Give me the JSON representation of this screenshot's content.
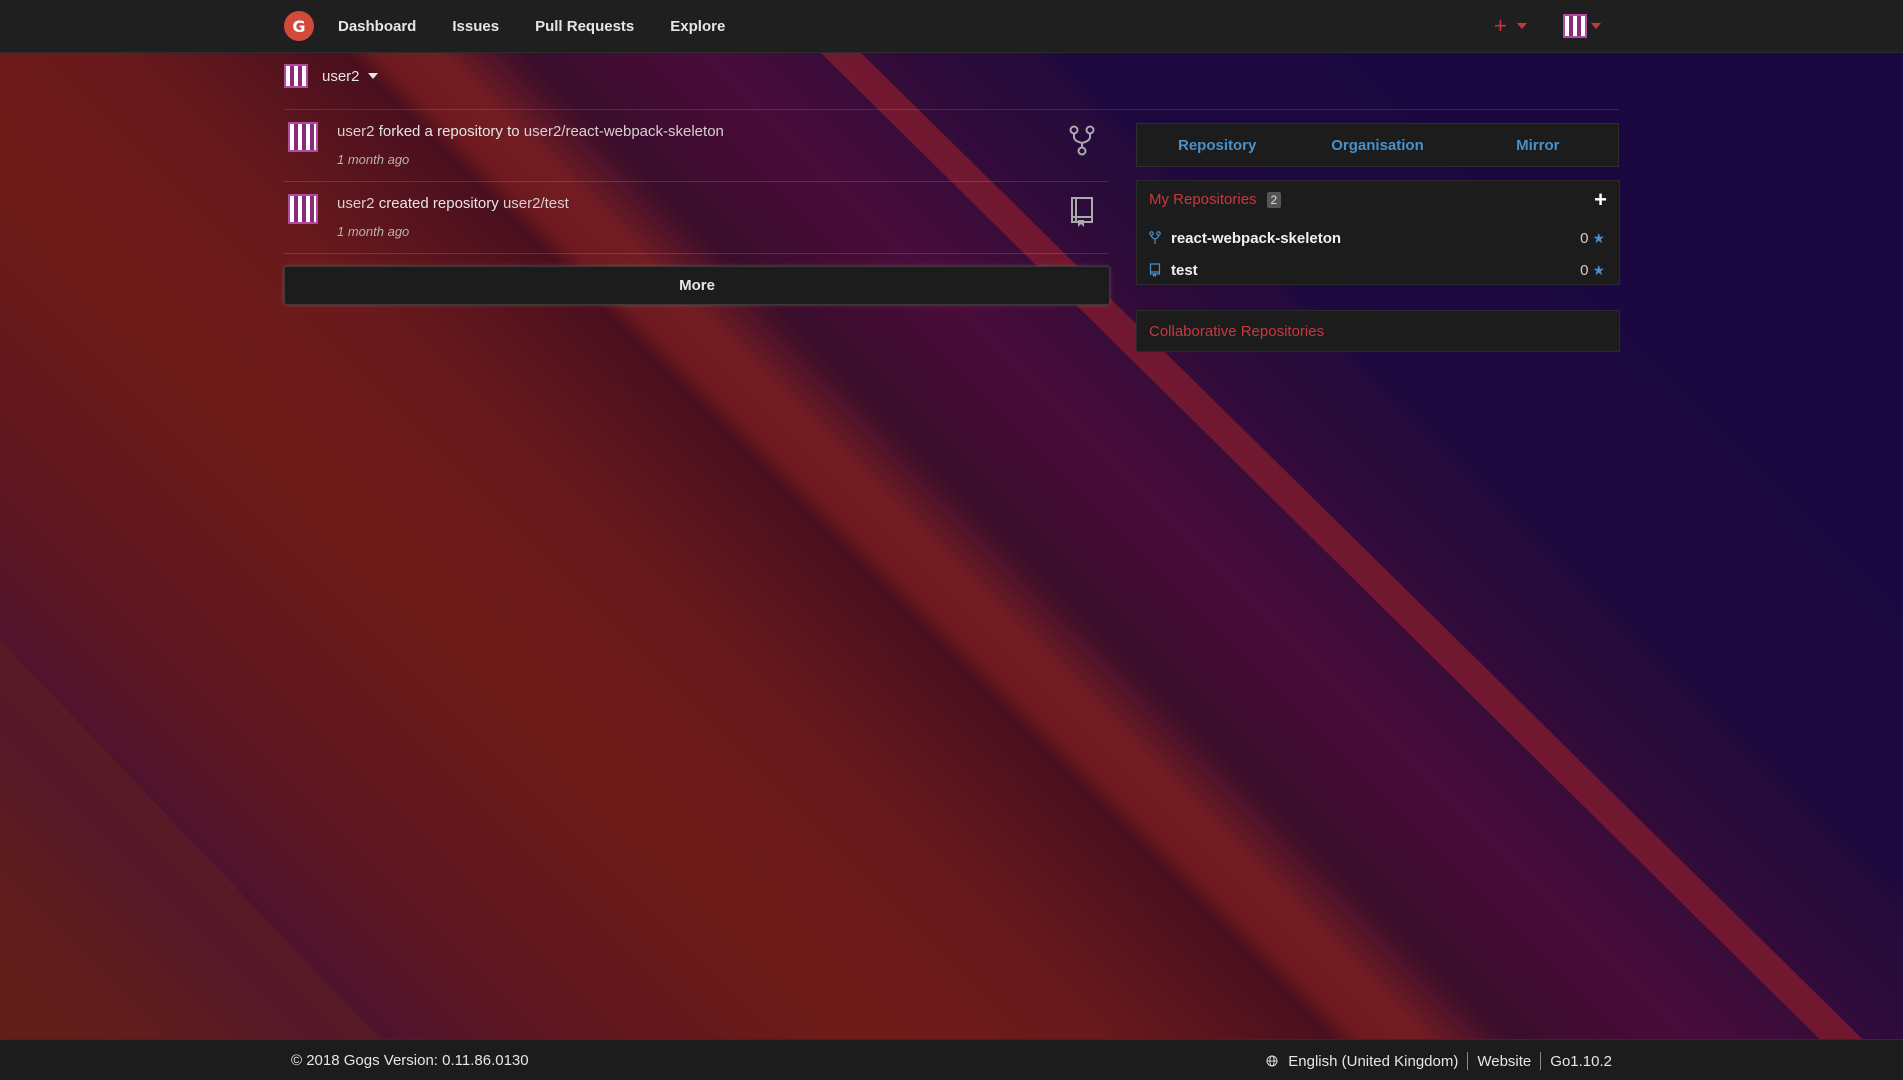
{
  "nav": {
    "logo_letter": "G",
    "items": [
      {
        "label": "Dashboard"
      },
      {
        "label": "Issues"
      },
      {
        "label": "Pull Requests"
      },
      {
        "label": "Explore"
      }
    ],
    "create_label": "+"
  },
  "context": {
    "user": "user2"
  },
  "feed": [
    {
      "user": "user2",
      "action": "forked a repository to",
      "target": "user2/react-webpack-skeleton",
      "time": "1 month ago",
      "icon": "repo-forked-icon"
    },
    {
      "user": "user2",
      "action": "created repository",
      "target": "user2/test",
      "time": "1 month ago",
      "icon": "repo-icon"
    }
  ],
  "more_label": "More",
  "sidebar": {
    "tabs": [
      {
        "label": "Repository"
      },
      {
        "label": "Organisation"
      },
      {
        "label": "Mirror"
      }
    ],
    "my_repos": {
      "title": "My Repositories",
      "count": "2",
      "add_label": "+",
      "items": [
        {
          "name": "react-webpack-skeleton",
          "stars": "0",
          "icon": "repo-forked-icon"
        },
        {
          "name": "test",
          "stars": "0",
          "icon": "repo-icon"
        }
      ]
    },
    "collab_title": "Collaborative Repositories"
  },
  "footer": {
    "copyright": "© 2018 Gogs Version: 0.11.86.0130",
    "language": "English (United Kingdom)",
    "website": "Website",
    "go_version": "Go1.10.2"
  },
  "colors": {
    "accent_red": "#c9373d",
    "link_blue": "#4a90c9",
    "bar_bg": "#1c1c1c"
  }
}
